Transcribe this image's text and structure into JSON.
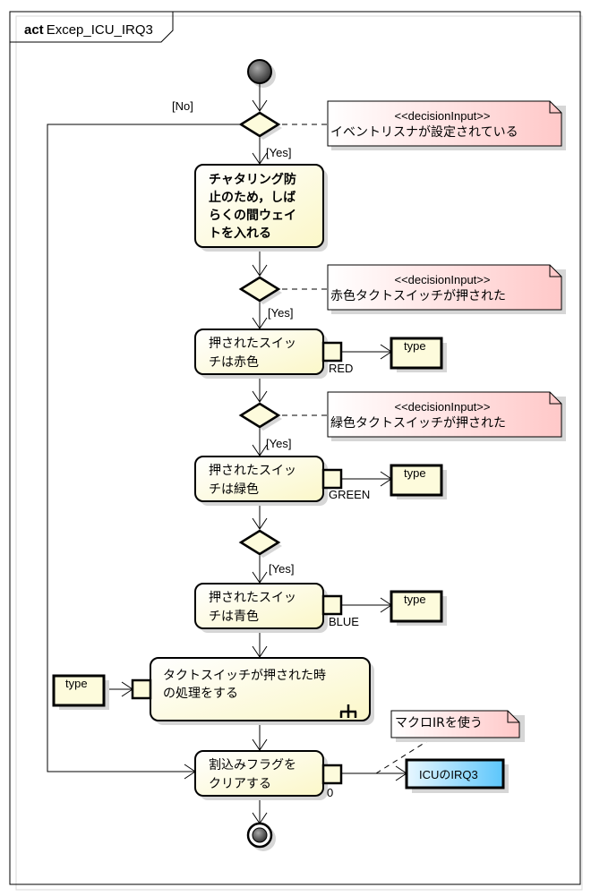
{
  "frame": {
    "keyword": "act",
    "name": "Excep_ICU_IRQ3"
  },
  "colors": {
    "action_fill_start": "#ffffff",
    "action_fill_end": "#fbf8cc",
    "note_fill_start": "#ffffff",
    "note_fill_end": "#ffcccc",
    "object_blue_start": "#e6f6ff",
    "object_blue_end": "#66ccff",
    "stroke": "#000000",
    "shadow": "#d6d6d6"
  },
  "guards": {
    "no": "[No]",
    "yes1": "[Yes]",
    "yes2": "[Yes]",
    "yes3": "[Yes]",
    "yes4": "[Yes]"
  },
  "notes": [
    {
      "stereotype": "<<decisionInput>>",
      "text": "イベントリスナが設定されている"
    },
    {
      "stereotype": "<<decisionInput>>",
      "text": "赤色タクトスイッチが押された"
    },
    {
      "stereotype": "<<decisionInput>>",
      "text": "緑色タクトスイッチが押された"
    },
    {
      "stereotype": "",
      "text": "マクロIRを使う"
    }
  ],
  "actions": [
    {
      "lines": [
        "チャタリング防",
        "止のため，しば",
        "らくの間ウェイ",
        "トを入れる"
      ]
    },
    {
      "lines": [
        "押されたスイッ",
        "チは赤色"
      ],
      "pin_label": "RED"
    },
    {
      "lines": [
        "押されたスイッ",
        "チは緑色"
      ],
      "pin_label": "GREEN"
    },
    {
      "lines": [
        "押されたスイッ",
        "チは青色"
      ],
      "pin_label": "BLUE"
    },
    {
      "lines": [
        "タクトスイッチが押された時",
        "の処理をする"
      ],
      "icon": "call-behavior-rake-icon"
    },
    {
      "lines": [
        "割込みフラグを",
        "クリアする"
      ],
      "pin_label": "0"
    }
  ],
  "objects": {
    "type_red": "type",
    "type_green": "type",
    "type_blue": "type",
    "type_input": "type",
    "icu_irq3": "ICUのIRQ3"
  }
}
